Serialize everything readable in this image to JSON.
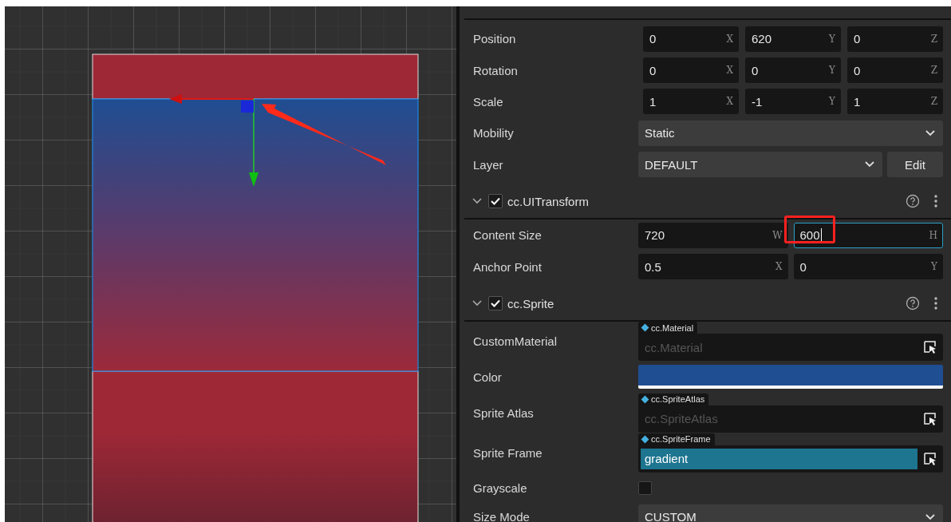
{
  "inspector": {
    "node_properties": [
      {
        "kind": "vec3",
        "label": "Position",
        "fields": [
          {
            "value": "0",
            "axis": "X"
          },
          {
            "value": "620",
            "axis": "Y"
          },
          {
            "value": "0",
            "axis": "Z"
          }
        ]
      },
      {
        "kind": "vec3",
        "label": "Rotation",
        "fields": [
          {
            "value": "0",
            "axis": "X"
          },
          {
            "value": "0",
            "axis": "Y"
          },
          {
            "value": "0",
            "axis": "Z"
          }
        ]
      },
      {
        "kind": "vec3",
        "label": "Scale",
        "fields": [
          {
            "value": "1",
            "axis": "X"
          },
          {
            "value": "-1",
            "axis": "Y"
          },
          {
            "value": "1",
            "axis": "Z"
          }
        ]
      },
      {
        "kind": "select",
        "label": "Mobility",
        "value": "Static"
      },
      {
        "kind": "select_button",
        "label": "Layer",
        "value": "DEFAULT",
        "button": "Edit"
      }
    ],
    "components": [
      {
        "title": "cc.UITransform",
        "expanded": true,
        "enabled": true,
        "properties": [
          {
            "kind": "vec2",
            "label": "Content Size",
            "fields": [
              {
                "value": "720",
                "axis": "W",
                "focused": false,
                "highlighted": false
              },
              {
                "value": "600",
                "axis": "H",
                "focused": true,
                "highlighted": true
              }
            ]
          },
          {
            "kind": "vec2",
            "label": "Anchor Point",
            "fields": [
              {
                "value": "0.5",
                "axis": "X",
                "focused": false,
                "highlighted": false
              },
              {
                "value": "0",
                "axis": "Y",
                "focused": false,
                "highlighted": false
              }
            ]
          }
        ]
      },
      {
        "title": "cc.Sprite",
        "expanded": true,
        "enabled": true,
        "properties": [
          {
            "kind": "asset",
            "label": "CustomMaterial",
            "type": "cc.Material",
            "placeholder": "cc.Material"
          },
          {
            "kind": "color",
            "label": "Color",
            "color": "#1f4e92"
          },
          {
            "kind": "asset",
            "label": "Sprite Atlas",
            "type": "cc.SpriteAtlas",
            "placeholder": "cc.SpriteAtlas"
          },
          {
            "kind": "asset",
            "label": "Sprite Frame",
            "type": "cc.SpriteFrame",
            "value": "gradient"
          },
          {
            "kind": "checkbox",
            "label": "Grayscale",
            "checked": false
          },
          {
            "kind": "select",
            "label": "Size Mode",
            "value": "CUSTOM"
          }
        ]
      }
    ]
  }
}
